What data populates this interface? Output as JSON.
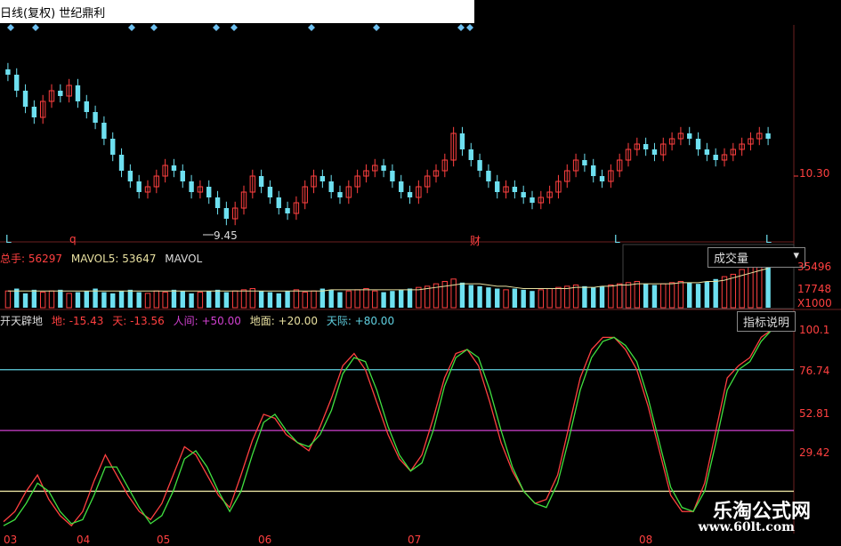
{
  "window": {
    "title": "日线(复权)  世纪鼎利"
  },
  "price_panel": {
    "marker_L_left": "L",
    "marker_q": "q",
    "marker_cai": "财",
    "marker_L_mid": "L",
    "marker_L_right": "L",
    "low_annotation": "9.45",
    "axis_label": "10.30"
  },
  "volume_panel": {
    "label_total": "总手: 56297",
    "label_mavol5": "MAVOL5: 53647",
    "label_mavol": "MAVOL",
    "dropdown_label": "成交量",
    "axis_labels": [
      "35496",
      "17748",
      "X1000"
    ]
  },
  "indicator_panel": {
    "name": "开天辟地",
    "button_label": "指标说明",
    "lines": [
      {
        "label": "地: -15.43",
        "color": "#ff4040"
      },
      {
        "label": "天: -13.56",
        "color": "#ff4040"
      },
      {
        "label": "人间: +50.00",
        "color": "#d040d0"
      },
      {
        "label": "地面: +20.00",
        "color": "#e8e0a0"
      },
      {
        "label": "天际: +80.00",
        "color": "#60d0e0"
      }
    ],
    "axis_labels": [
      "100.1",
      "76.74",
      "52.81",
      "29.42"
    ]
  },
  "x_axis_labels": [
    "03",
    "04",
    "05",
    "06",
    "07",
    "08"
  ],
  "watermark": {
    "line1": "乐淘公式网",
    "line2": "www.60lt.com"
  },
  "colors": {
    "up": "#ff4040",
    "down": "#6ee0f0",
    "cyan_line": "#60d0e0",
    "magenta_line": "#d040d0",
    "cream_line": "#e8e0a0",
    "green_line": "#40e040"
  },
  "chart_data": [
    {
      "type": "candlestick",
      "label_points": {
        "low": 9.45,
        "axis": 10.3
      },
      "closes": [
        12.2,
        11.9,
        11.6,
        11.4,
        11.7,
        11.9,
        11.8,
        12.0,
        11.7,
        11.5,
        11.3,
        11.0,
        10.7,
        10.4,
        10.2,
        10.0,
        10.1,
        10.3,
        10.5,
        10.4,
        10.2,
        10.0,
        10.1,
        9.9,
        9.7,
        9.5,
        9.7,
        10.0,
        10.3,
        10.1,
        9.9,
        9.7,
        9.6,
        9.8,
        10.1,
        10.3,
        10.2,
        10.0,
        9.9,
        10.1,
        10.3,
        10.4,
        10.5,
        10.4,
        10.2,
        10.0,
        9.9,
        10.1,
        10.3,
        10.4,
        10.6,
        11.1,
        10.8,
        10.6,
        10.4,
        10.2,
        10.0,
        10.1,
        10.0,
        9.9,
        9.8,
        9.9,
        10.0,
        10.2,
        10.4,
        10.6,
        10.5,
        10.3,
        10.2,
        10.4,
        10.6,
        10.8,
        10.9,
        10.8,
        10.7,
        10.9,
        11.0,
        11.1,
        11.0,
        10.8,
        10.7,
        10.6,
        10.7,
        10.8,
        10.9,
        11.0,
        11.1,
        11.0
      ]
    },
    {
      "type": "bar",
      "name": "成交量",
      "values": [
        14,
        16,
        12,
        15,
        13,
        14,
        15,
        12,
        13,
        14,
        16,
        13,
        12,
        14,
        15,
        13,
        12,
        14,
        13,
        15,
        14,
        12,
        13,
        14,
        15,
        13,
        14,
        15,
        16,
        14,
        13,
        12,
        14,
        15,
        13,
        14,
        16,
        15,
        13,
        14,
        15,
        16,
        14,
        13,
        14,
        15,
        16,
        17,
        18,
        20,
        22,
        24,
        21,
        19,
        18,
        17,
        16,
        15,
        16,
        15,
        14,
        15,
        16,
        17,
        18,
        19,
        18,
        17,
        18,
        19,
        20,
        21,
        22,
        20,
        19,
        20,
        21,
        22,
        21,
        20,
        22,
        24,
        26,
        28,
        32,
        36,
        34,
        35
      ],
      "ma": [
        14,
        14,
        14,
        14,
        14,
        14,
        14,
        14,
        14,
        14,
        14,
        14,
        14,
        14,
        14,
        14,
        14,
        14,
        14,
        14,
        14,
        14,
        14,
        14,
        14,
        14,
        14,
        14,
        14,
        14,
        14,
        14,
        14,
        14,
        14,
        14,
        14,
        15,
        15,
        15,
        15,
        15,
        15,
        15,
        15,
        15,
        15,
        15,
        16,
        17,
        18,
        19,
        20,
        20,
        20,
        19,
        18,
        18,
        17,
        16,
        16,
        16,
        16,
        16,
        16,
        17,
        17,
        17,
        18,
        18,
        19,
        19,
        20,
        20,
        20,
        20,
        20,
        21,
        21,
        21,
        22,
        22,
        23,
        25,
        27,
        29,
        31,
        33
      ],
      "ylim": [
        0,
        35496
      ]
    },
    {
      "type": "line",
      "name": "开天辟地",
      "ylim": [
        0,
        100.1
      ],
      "hlines": [
        {
          "value": 80,
          "color": "#60d0e0"
        },
        {
          "value": 50,
          "color": "#d040d0"
        },
        {
          "value": 20,
          "color": "#e8e0a0"
        }
      ],
      "series": [
        {
          "name": "地",
          "color": "#ff4040",
          "values": [
            5,
            10,
            20,
            28,
            16,
            8,
            3,
            10,
            25,
            38,
            28,
            18,
            10,
            6,
            14,
            28,
            42,
            38,
            28,
            18,
            12,
            28,
            45,
            58,
            56,
            48,
            44,
            40,
            52,
            66,
            82,
            88,
            80,
            64,
            48,
            36,
            30,
            38,
            56,
            76,
            88,
            90,
            82,
            64,
            44,
            30,
            20,
            14,
            16,
            28,
            52,
            76,
            90,
            96,
            96,
            90,
            80,
            62,
            40,
            18,
            10,
            10,
            24,
            50,
            76,
            82,
            86,
            96,
            100
          ]
        },
        {
          "name": "天",
          "color": "#40e040",
          "values": [
            3,
            6,
            14,
            24,
            20,
            10,
            4,
            6,
            18,
            32,
            32,
            22,
            12,
            4,
            8,
            20,
            36,
            40,
            32,
            20,
            10,
            20,
            38,
            54,
            58,
            50,
            44,
            42,
            48,
            60,
            78,
            86,
            84,
            70,
            52,
            38,
            30,
            34,
            50,
            72,
            86,
            90,
            86,
            70,
            50,
            32,
            20,
            14,
            12,
            24,
            46,
            70,
            86,
            94,
            96,
            92,
            84,
            66,
            44,
            22,
            12,
            10,
            20,
            44,
            70,
            80,
            84,
            94,
            100
          ]
        }
      ]
    }
  ]
}
